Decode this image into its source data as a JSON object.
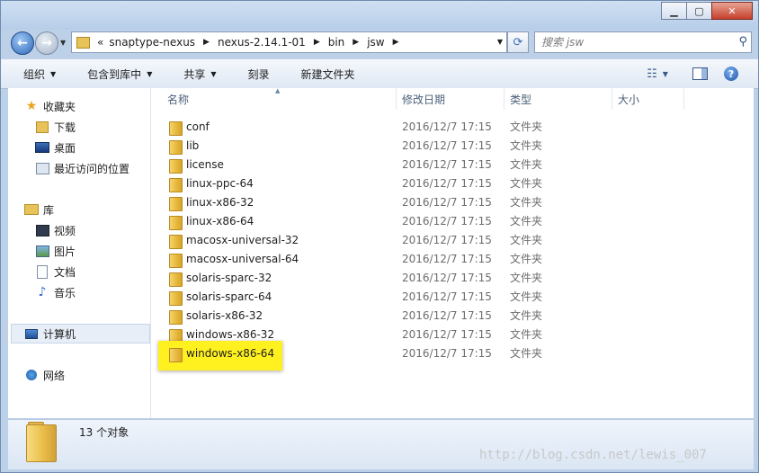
{
  "address": {
    "overflow": "«",
    "crumbs": [
      "snaptype-nexus",
      "nexus-2.14.1-01",
      "bin",
      "jsw"
    ]
  },
  "search": {
    "placeholder": "搜索 jsw"
  },
  "toolbar": {
    "organize": "组织",
    "include_library": "包含到库中",
    "share": "共享",
    "burn": "刻录",
    "new_folder": "新建文件夹"
  },
  "sidebar": {
    "favorites": "收藏夹",
    "downloads": "下载",
    "desktop": "桌面",
    "recent": "最近访问的位置",
    "libraries": "库",
    "videos": "视频",
    "pictures": "图片",
    "documents": "文档",
    "music": "音乐",
    "computer": "计算机",
    "network": "网络"
  },
  "columns": {
    "name": "名称",
    "modified": "修改日期",
    "type": "类型",
    "size": "大小"
  },
  "files": [
    {
      "name": "conf",
      "modified": "2016/12/7 17:15",
      "type": "文件夹"
    },
    {
      "name": "lib",
      "modified": "2016/12/7 17:15",
      "type": "文件夹"
    },
    {
      "name": "license",
      "modified": "2016/12/7 17:15",
      "type": "文件夹"
    },
    {
      "name": "linux-ppc-64",
      "modified": "2016/12/7 17:15",
      "type": "文件夹"
    },
    {
      "name": "linux-x86-32",
      "modified": "2016/12/7 17:15",
      "type": "文件夹"
    },
    {
      "name": "linux-x86-64",
      "modified": "2016/12/7 17:15",
      "type": "文件夹"
    },
    {
      "name": "macosx-universal-32",
      "modified": "2016/12/7 17:15",
      "type": "文件夹"
    },
    {
      "name": "macosx-universal-64",
      "modified": "2016/12/7 17:15",
      "type": "文件夹"
    },
    {
      "name": "solaris-sparc-32",
      "modified": "2016/12/7 17:15",
      "type": "文件夹"
    },
    {
      "name": "solaris-sparc-64",
      "modified": "2016/12/7 17:15",
      "type": "文件夹"
    },
    {
      "name": "solaris-x86-32",
      "modified": "2016/12/7 17:15",
      "type": "文件夹"
    },
    {
      "name": "windows-x86-32",
      "modified": "2016/12/7 17:15",
      "type": "文件夹"
    },
    {
      "name": "windows-x86-64",
      "modified": "2016/12/7 17:15",
      "type": "文件夹",
      "highlighted": true
    }
  ],
  "status": {
    "count": "13 个对象"
  },
  "watermark": "http://blog.csdn.net/lewis_007",
  "colors": {
    "highlight": "#fff11f",
    "window_frame": "#bcd0e8"
  }
}
